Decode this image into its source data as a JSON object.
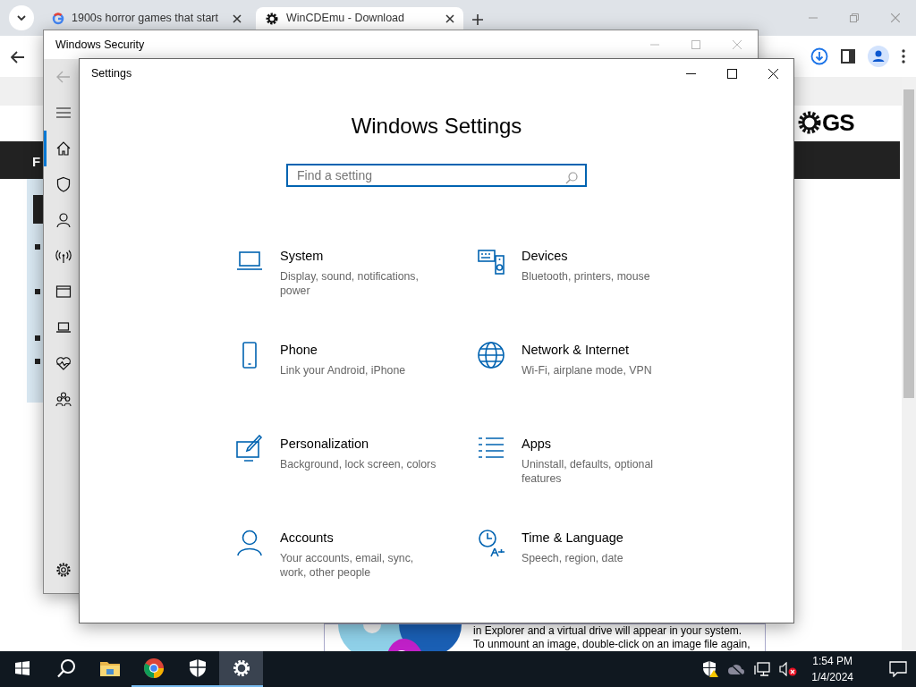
{
  "browser": {
    "tabs": [
      {
        "kind": "google",
        "title": "1900s horror games that start",
        "selected": false
      },
      {
        "kind": "gear",
        "title": "WinCDEmu - Download",
        "selected": true
      }
    ],
    "page": {
      "nav_letter": "F",
      "logo_text": "GS",
      "body_lines": [
        "in Explorer and a virtual drive will appear in your system.",
        "To unmount an image, double-click on an image file again,"
      ]
    }
  },
  "security": {
    "title": "Windows Security",
    "nav": [
      {
        "kind": "home",
        "selected": true
      },
      {
        "kind": "shield",
        "selected": false
      },
      {
        "kind": "person",
        "selected": false
      },
      {
        "kind": "antenna",
        "selected": false
      },
      {
        "kind": "window",
        "selected": false
      },
      {
        "kind": "laptop",
        "selected": false
      },
      {
        "kind": "heart",
        "selected": false
      },
      {
        "kind": "family",
        "selected": false
      }
    ]
  },
  "settings": {
    "title": "Settings",
    "heading": "Windows Settings",
    "search": {
      "placeholder": "Find a setting"
    },
    "categories": [
      {
        "kind": "system",
        "name": "System",
        "description": "Display, sound, notifications, power"
      },
      {
        "kind": "devices",
        "name": "Devices",
        "description": "Bluetooth, printers, mouse"
      },
      {
        "kind": "phone",
        "name": "Phone",
        "description": "Link your Android, iPhone"
      },
      {
        "kind": "network",
        "name": "Network & Internet",
        "description": "Wi-Fi, airplane mode, VPN"
      },
      {
        "kind": "personalization",
        "name": "Personalization",
        "description": "Background, lock screen, colors"
      },
      {
        "kind": "apps",
        "name": "Apps",
        "description": "Uninstall, defaults, optional features"
      },
      {
        "kind": "accounts",
        "name": "Accounts",
        "description": "Your accounts, email, sync, work, other people"
      },
      {
        "kind": "time",
        "name": "Time & Language",
        "description": "Speech, region, date"
      }
    ]
  },
  "taskbar": {
    "apps": [
      {
        "kind": "start",
        "running": false,
        "selected": false
      },
      {
        "kind": "search",
        "running": false,
        "selected": false
      },
      {
        "kind": "explorer",
        "running": false,
        "selected": false
      },
      {
        "kind": "chrome",
        "running": true,
        "selected": false
      },
      {
        "kind": "defender",
        "running": true,
        "selected": false
      },
      {
        "kind": "settings",
        "running": true,
        "selected": true
      }
    ],
    "time": "1:54 PM",
    "date": "1/4/2024"
  }
}
